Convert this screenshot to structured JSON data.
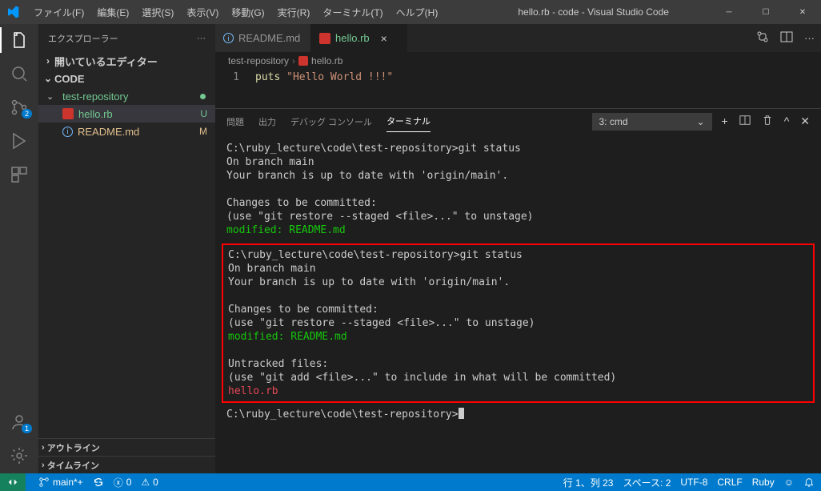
{
  "menu": {
    "file": "ファイル(F)",
    "edit": "編集(E)",
    "select": "選択(S)",
    "view": "表示(V)",
    "go": "移動(G)",
    "run": "実行(R)",
    "terminal": "ターミナル(T)",
    "help": "ヘルプ(H)"
  },
  "title": "hello.rb - code - Visual Studio Code",
  "sidebar": {
    "header": "エクスプローラー",
    "openEditors": "開いているエディター",
    "code": "CODE",
    "repo": "test-repository",
    "files": [
      {
        "name": "hello.rb",
        "status": "U",
        "cls": "green"
      },
      {
        "name": "README.md",
        "status": "M",
        "cls": "yellow"
      }
    ],
    "outline": "アウトライン",
    "timeline": "タイムライン"
  },
  "activity": {
    "scm_badge": "2",
    "acc_badge": "1"
  },
  "tabs": [
    {
      "name": "README.md",
      "icon": "info"
    },
    {
      "name": "hello.rb",
      "icon": "ruby",
      "active": true
    }
  ],
  "breadcrumb": {
    "a": "test-repository",
    "b": "hello.rb"
  },
  "code": {
    "line": "1",
    "puts": "puts",
    "str": "\"Hello World !!!\""
  },
  "panel": {
    "problems": "問題",
    "output": "出力",
    "debug": "デバッグ コンソール",
    "terminal": "ターミナル",
    "selector": "3: cmd"
  },
  "term": {
    "prompt": "C:\\ruby_lecture\\code\\test-repository>",
    "cmd": "git status",
    "branch": "On branch main",
    "uptodate": "Your branch is up to date with 'origin/main'.",
    "tobc": "Changes to be committed:",
    "usere": "  (use \"git restore --staged <file>...\" to unstage)",
    "modified": "        modified:   README.md",
    "untracked": "Untracked files:",
    "useadd": "  (use \"git add <file>...\" to include in what will be committed)",
    "hellofile": "        hello.rb"
  },
  "status": {
    "branch": "main*+",
    "sync": "",
    "err": "0",
    "warn": "0",
    "pos": "行 1、列 23",
    "spaces": "スペース: 2",
    "enc": "UTF-8",
    "eol": "CRLF",
    "lang": "Ruby"
  }
}
